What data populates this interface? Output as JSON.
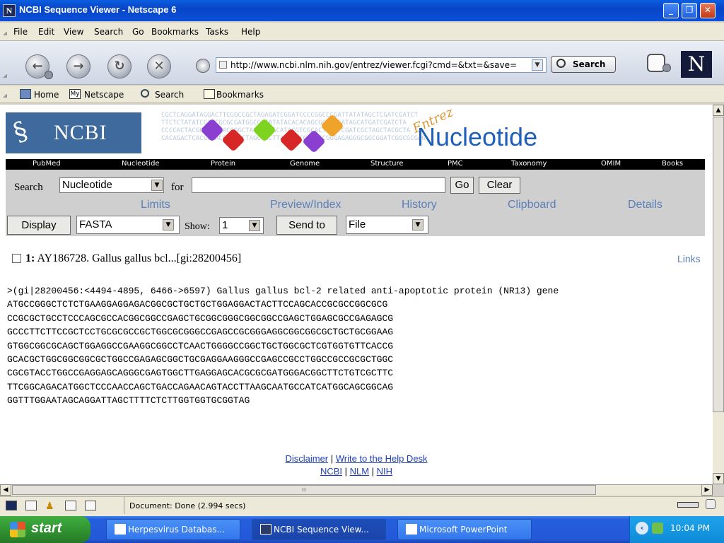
{
  "window": {
    "title": "NCBI Sequence Viewer - Netscape 6",
    "controls": [
      "minimize",
      "maximize",
      "close"
    ]
  },
  "menubar": {
    "items": [
      "File",
      "Edit",
      "View",
      "Search",
      "Go",
      "Bookmarks",
      "Tasks",
      "Help"
    ]
  },
  "navbar": {
    "url": "http://www.ncbi.nlm.nih.gov/entrez/viewer.fcgi?cmd=&txt=&save=",
    "search_label": "Search",
    "logo": "N"
  },
  "personal_toolbar": {
    "home": "Home",
    "netscape": "Netscape",
    "netscape_icon": "My",
    "search": "Search",
    "bookmarks": "Bookmarks"
  },
  "page": {
    "ncbi_logo": "NCBI",
    "entrez_word": "Entrez",
    "banner_title": "Nucleotide",
    "banner_sequence_text": "CGCTCAGGATAGGACTTCGGCCGCTAGAGATCGGATCCCCGGCCCGATTATATAGCTCGATCGATCT\nTTCTCTATATCGATCGCGCGATGGCGCTATATACACACAGCGCGCGGATAGCATGATCGATCTA\nCCCCACTACGCATGCTACCGGCTAGCTTCGCATACGTCGCACTGCGTCGATCGCTAGCTACGCTA\nCACAGACTCACGCTACGTCACCTAGCTACTTACTAACCAATTCGGGAGAGGGCGGCGGATCGGCGCGAG",
    "db_nav": [
      "PubMed",
      "Nucleotide",
      "Protein",
      "Genome",
      "Structure",
      "PMC",
      "Taxonomy",
      "OMIM",
      "Books"
    ],
    "search_label": "Search",
    "search_db": "Nucleotide",
    "for_label": "for",
    "search_query": "",
    "go_button": "Go",
    "clear_button": "Clear",
    "tabs": [
      "Limits",
      "Preview/Index",
      "History",
      "Clipboard",
      "Details"
    ],
    "display_button": "Display",
    "display_format": "FASTA",
    "show_label": "Show:",
    "show_value": "1",
    "send_to_button": "Send to",
    "send_to_target": "File",
    "record_number": "1:",
    "record_title": "AY186728. Gallus gallus bcl...[gi:28200456]",
    "links_label": "Links",
    "fasta_text": ">(gi|28200456:<4494-4895, 6466->6597) Gallus gallus bcl-2 related anti-apoptotic protein (NR13) gene\nATGCCGGGCTCTCTGAAGGAGGAGACGGCGCTGCTGCTGGAGGACTACTTCCAGCACCGCGCCGGCGCG\nCCGCGCTGCCTCCCAGCGCCACGGCGGCCGAGCTGCGGCGGGCGGCGGCCGAGCTGGAGCGCCGAGAGCG\nGCCCTTCTTCCGCTCCTGCGCGCCGCTGGCGCGGGCCGAGCCGCGGGAGGCGGCGGCGCTGCTGCGGAAG\nGTGGCGGCGCAGCTGGAGGCCGAAGGCGGCCTCAACTGGGGCCGGCTGCTGGCGCTCGTGGTGTTCACCG\nGCACGCTGGCGGCGGCGCTGGCCGAGAGCGGCTGCGAGGAAGGGCCGAGCCGCCTGGCCGCCGCGCTGGC\nCGCGTACCTGGCCGAGGAGCAGGGCGAGTGGCTTGAGGAGCACGCGCGATGGGACGGCTTCTGTCGCTTC\nTTCGGCAGACATGGCTCCCAACCAGCTGACCAGAACAGTACCTTAAGCAATGCCATCATGGCAGCGGCAG\nGGTTTGGAATAGCAGGATTAGCTTTTCTCTTGGTGGTGCGGTAG",
    "footer_disclaimer": "Disclaimer",
    "footer_sep1": " | ",
    "footer_helpdesk": "Write to the Help Desk",
    "footer_ncbi": "NCBI",
    "footer_sep2": " | ",
    "footer_nlm": "NLM",
    "footer_sep3": " | ",
    "footer_nih": "NIH"
  },
  "statusbar": {
    "text": "Document: Done (2.994 secs)"
  },
  "taskbar": {
    "start": "start",
    "tasks": [
      "Herpesvirus Databas...",
      "NCBI Sequence View...",
      "Microsoft PowerPoint"
    ],
    "clock": "10:04 PM"
  },
  "scrollbar": {
    "h_thumb_grip": "III"
  },
  "colors": {
    "title_bar": "#0a50d8",
    "ncbi_blue": "#3e6a9e",
    "link_blue": "#5b7fb8",
    "taskbar": "#245edb",
    "start_green": "#2f8f2f"
  }
}
